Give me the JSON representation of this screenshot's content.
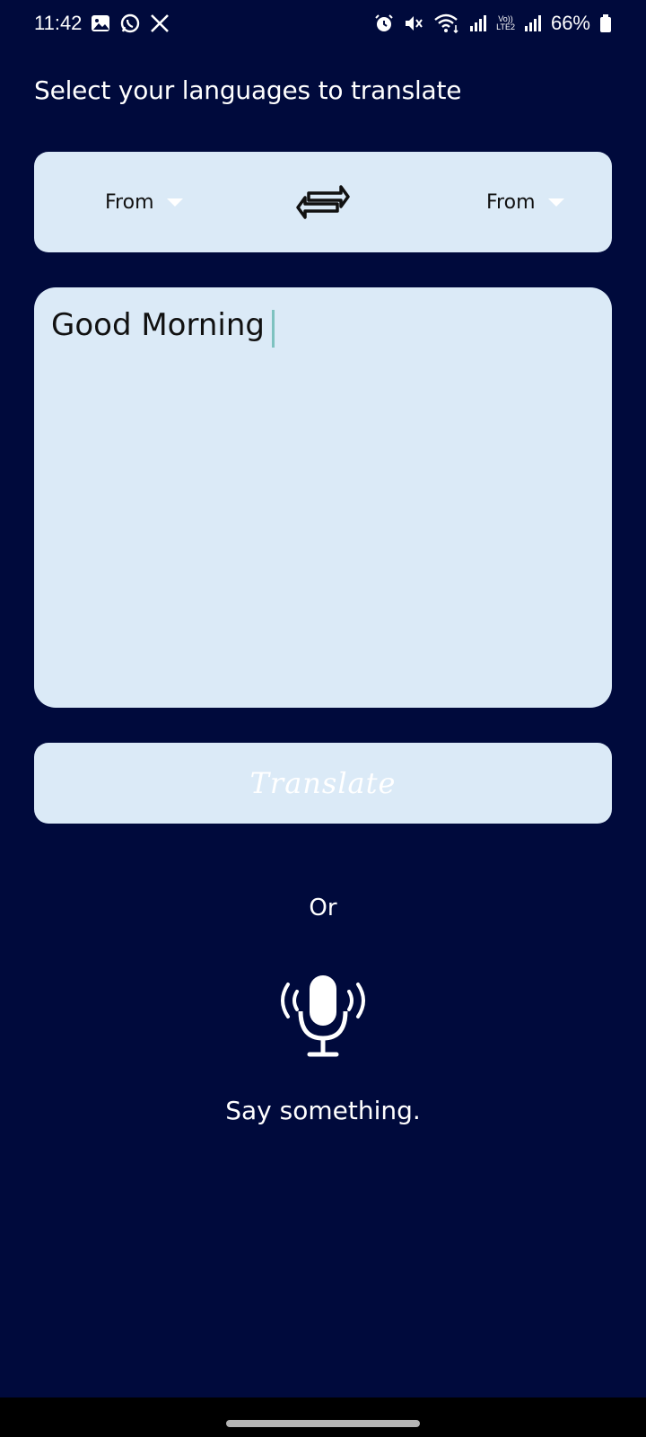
{
  "status_bar": {
    "time": "11:42",
    "battery": "66%",
    "left_icons": [
      "gallery-icon",
      "whatsapp-icon",
      "x-icon"
    ],
    "right_icons": [
      "alarm-icon",
      "mute-icon",
      "wifi-icon",
      "signal-icon",
      "volte-icon",
      "signal-icon",
      "battery-icon"
    ],
    "volte_top": "Vo))",
    "volte_bottom": "LTE2"
  },
  "header": {
    "title": "Select your languages to translate"
  },
  "language_selector": {
    "from_label": "From",
    "to_label": "From",
    "swap_icon": "swap-arrows-icon"
  },
  "input": {
    "value": "Good Morning"
  },
  "actions": {
    "translate_label": "Translate",
    "or_label": "Or",
    "mic_icon": "microphone-icon",
    "voice_prompt": "Say something."
  },
  "colors": {
    "background": "#000a3c",
    "card": "#dbeaf7",
    "caret": "#7ec2c0"
  }
}
